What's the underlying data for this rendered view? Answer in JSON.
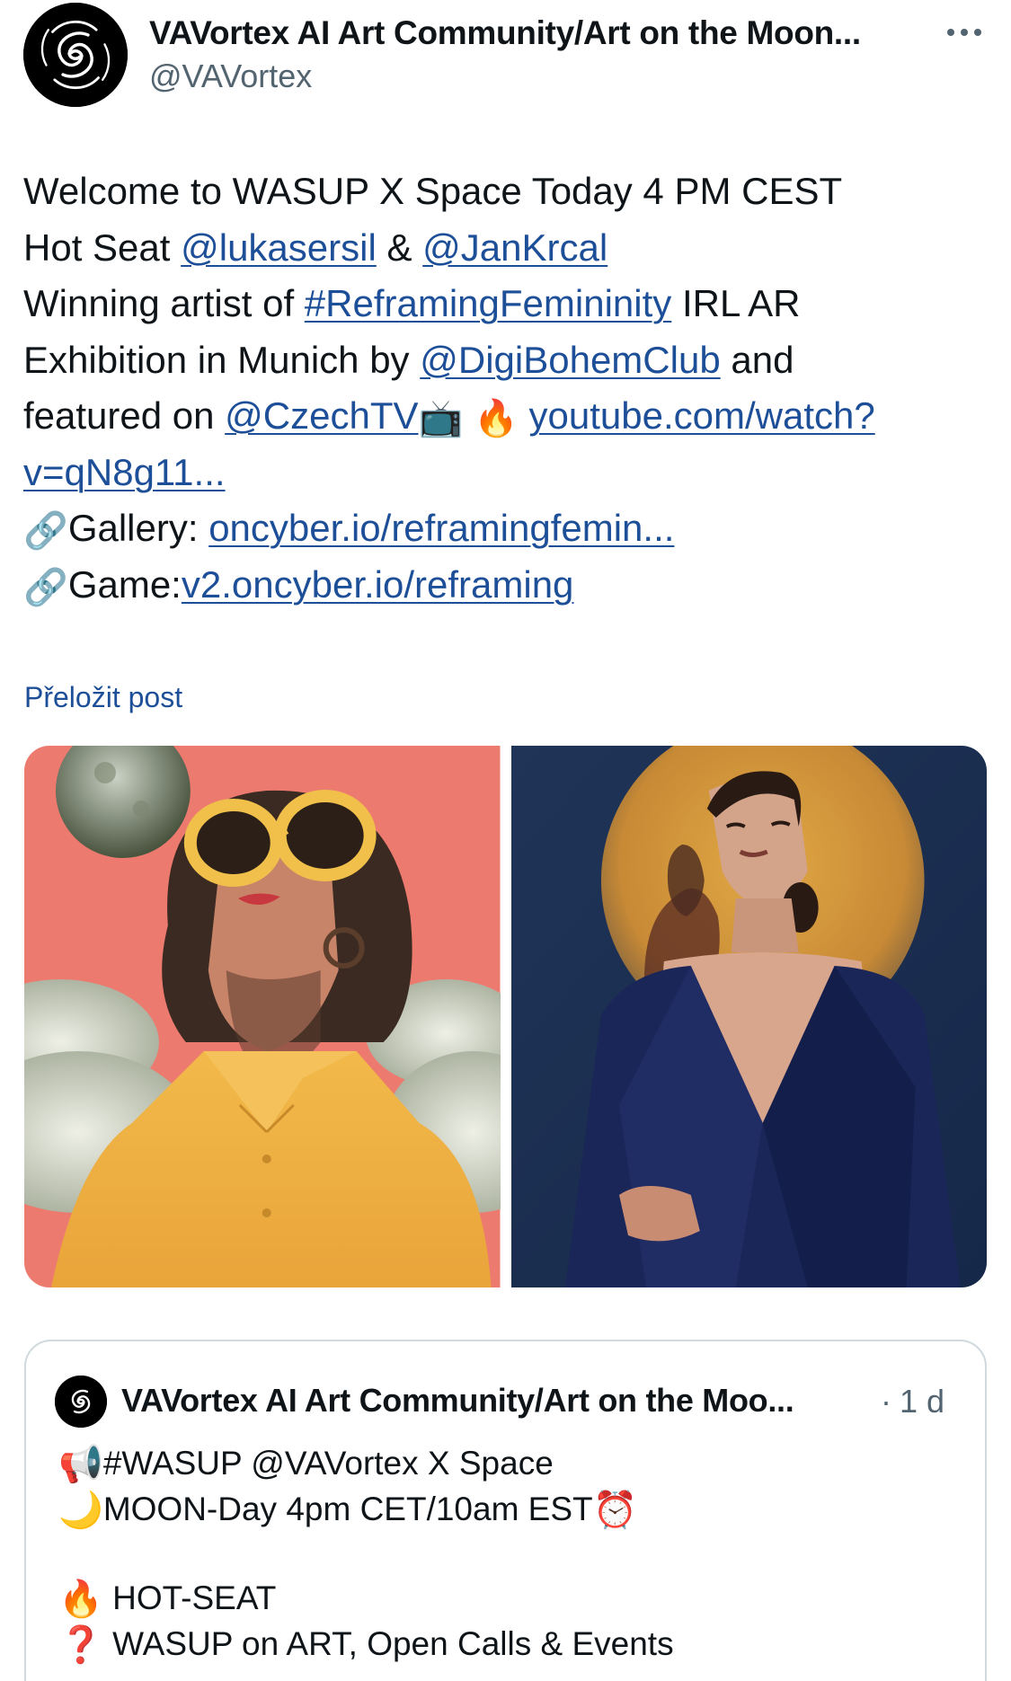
{
  "author": {
    "display_name": "VAVortex AI Art Community/Art on the Moon...",
    "handle": "@VAVortex"
  },
  "post": {
    "line1": "Welcome to WASUP X Space Today 4 PM CEST",
    "line2_prefix": "Hot Seat ",
    "mention1": "@lukasersil",
    "line2_mid": " & ",
    "mention2": "@JanKrcal",
    "line3_prefix": "Winning artist of ",
    "hashtag": "#ReframingFemininity",
    "line3_suffix": " IRL AR",
    "line4_prefix": "Exhibition in Munich by ",
    "mention3": "@DigiBohemClub",
    "line4_suffix": " and",
    "line5_prefix": "featured on ",
    "mention4": "@CzechTV",
    "emoji_tv": "📺",
    "emoji_fire": "🔥",
    "link_youtube_1": "youtube.com/watch?",
    "link_youtube_2": "v=qN8g11...",
    "emoji_link": "🔗",
    "gallery_label": "Gallery: ",
    "gallery_link": "oncyber.io/reframingfemin...",
    "game_label": "Game:",
    "game_link": "v2.oncyber.io/reframing"
  },
  "translate_label": "Přeložit post",
  "quoted_post": {
    "display_name": "VAVortex AI Art Community/Art on the Moo...",
    "separator": "·",
    "time": "1 d",
    "line1_emoji": "📢",
    "line1": "#WASUP @VAVortex X Space",
    "line2_emoji": "🌙",
    "line2": "MOON-Day 4pm CET/10am EST",
    "line2_emoji_end": "⏰",
    "line3_emoji": "🔥",
    "line3": " HOT-SEAT",
    "line4_emoji": "❓",
    "line4": " WASUP on ART, Open Calls & Events"
  },
  "colors": {
    "link": "#1d4f99",
    "text": "#0f1419",
    "secondary": "#536471",
    "border": "#cfd9de"
  },
  "icons": {
    "more": "more-horizontal-icon",
    "avatar": "vortex-spiral-logo"
  }
}
